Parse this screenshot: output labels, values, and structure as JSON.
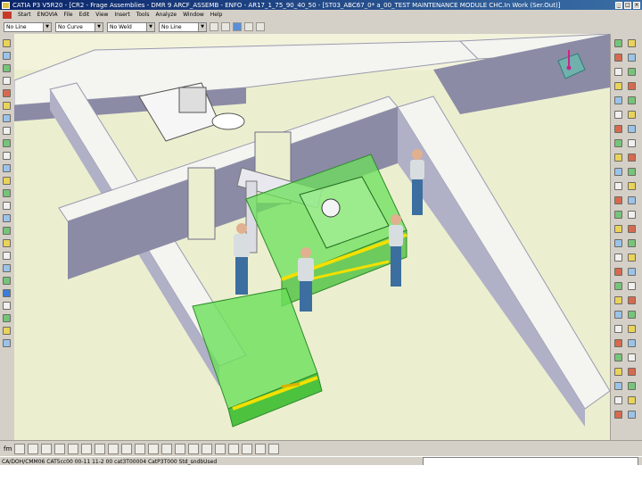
{
  "window": {
    "title": "CATIA P3 V5R20 - [CR2 - Frage Assemblies - DMR 9 ARCF_ASSEMB - ENFO - AR17_1_75_90_40_50 - [ST03_ABC67_0* a_00_TEST MAINTENANCE MODULE CHC.In Work (Ser.Out)]",
    "icon": "catia-app-icon"
  },
  "menubar": {
    "items": [
      "Start",
      "ENOVIA",
      "File",
      "Edit",
      "View",
      "Insert",
      "Tools",
      "Analyze",
      "Window",
      "Help"
    ]
  },
  "toolbar": {
    "combo_1": "No Line",
    "combo_2": "No Curve",
    "combo_3": "No Weld",
    "combo_4": "No Line"
  },
  "bottom_toolbar": {
    "label": "fm"
  },
  "statusbar": {
    "text": "CA/DOH/CMM06 CAT5cc00 00-11 11-2 00 cat3T00004 CatP3T000 Std_sndbUsed"
  },
  "icons": {
    "compass": "compass-icon",
    "minimize": "minimize-icon",
    "maximize": "maximize-icon",
    "close": "close-icon"
  },
  "colors": {
    "floor": "#ecefcf",
    "wall_top": "#f4f4f0",
    "wall_side": "#8b8ba6",
    "equipment_green": "#6be05a",
    "rail_yellow": "#f2e000",
    "worker_shirt": "#d8dde0",
    "worker_pants": "#3c6ea0",
    "titlebar": "#0a246a"
  }
}
